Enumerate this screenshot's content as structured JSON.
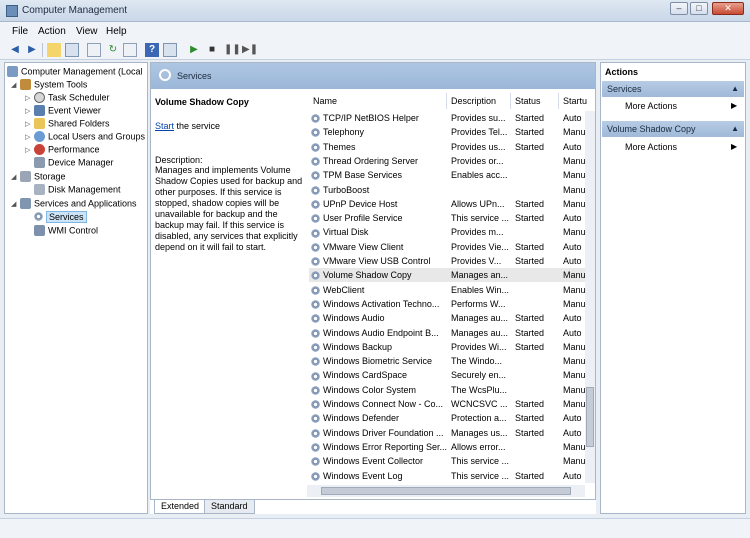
{
  "window": {
    "title": "Computer Management",
    "minimize": "–",
    "maximize": "□",
    "close": "✕"
  },
  "menu": [
    "File",
    "Action",
    "View",
    "Help"
  ],
  "tree": [
    {
      "label": "Computer Management (Local",
      "icon": "computer-icon",
      "arrow": ""
    },
    {
      "label": "System Tools",
      "icon": "tools-icon",
      "arrow": "◢"
    },
    {
      "label": "Task Scheduler",
      "icon": "clock-icon",
      "arrow": "▷"
    },
    {
      "label": "Event Viewer",
      "icon": "event-viewer-icon",
      "arrow": "▷"
    },
    {
      "label": "Shared Folders",
      "icon": "folder-icon",
      "arrow": "▷"
    },
    {
      "label": "Local Users and Groups",
      "icon": "users-icon",
      "arrow": "▷"
    },
    {
      "label": "Performance",
      "icon": "performance-icon",
      "arrow": "▷"
    },
    {
      "label": "Device Manager",
      "icon": "device-manager-icon",
      "arrow": ""
    },
    {
      "label": "Storage",
      "icon": "storage-icon",
      "arrow": "◢"
    },
    {
      "label": "Disk Management",
      "icon": "disk-icon",
      "arrow": ""
    },
    {
      "label": "Services and Applications",
      "icon": "services-apps-icon",
      "arrow": "◢"
    },
    {
      "label": "Services",
      "icon": "gear-icon",
      "arrow": ""
    },
    {
      "label": "WMI Control",
      "icon": "wmi-icon",
      "arrow": ""
    }
  ],
  "center": {
    "header_title": "Services",
    "selected_service": "Volume Shadow Copy",
    "start_link": "Start",
    "start_suffix": " the service",
    "desc_label": "Description:",
    "description": "Manages and implements Volume Shadow Copies used for backup and other purposes. If this service is stopped, shadow copies will be unavailable for backup and the backup may fail. If this service is disabled, any services that explicitly depend on it will fail to start."
  },
  "columns": [
    "Name",
    "Description",
    "Status",
    "Startu"
  ],
  "services": [
    {
      "name": "TCP/IP NetBIOS Helper",
      "desc": "Provides su...",
      "status": "Started",
      "startup": "Auto"
    },
    {
      "name": "Telephony",
      "desc": "Provides Tel...",
      "status": "Started",
      "startup": "Manu"
    },
    {
      "name": "Themes",
      "desc": "Provides us...",
      "status": "Started",
      "startup": "Auto"
    },
    {
      "name": "Thread Ordering Server",
      "desc": "Provides or...",
      "status": "",
      "startup": "Manu"
    },
    {
      "name": "TPM Base Services",
      "desc": "Enables acc...",
      "status": "",
      "startup": "Manu"
    },
    {
      "name": "TurboBoost",
      "desc": "",
      "status": "",
      "startup": "Manu"
    },
    {
      "name": "UPnP Device Host",
      "desc": "Allows UPn...",
      "status": "Started",
      "startup": "Manu"
    },
    {
      "name": "User Profile Service",
      "desc": "This service ...",
      "status": "Started",
      "startup": "Auto"
    },
    {
      "name": "Virtual Disk",
      "desc": "Provides m...",
      "status": "",
      "startup": "Manu"
    },
    {
      "name": "VMware View Client",
      "desc": "Provides Vie...",
      "status": "Started",
      "startup": "Auto"
    },
    {
      "name": "VMware View USB Control",
      "desc": "Provides V...",
      "status": "Started",
      "startup": "Auto"
    },
    {
      "name": "Volume Shadow Copy",
      "desc": "Manages an...",
      "status": "",
      "startup": "Manu"
    },
    {
      "name": "WebClient",
      "desc": "Enables Win...",
      "status": "",
      "startup": "Manu"
    },
    {
      "name": "Windows Activation Techno...",
      "desc": "Performs W...",
      "status": "",
      "startup": "Manu"
    },
    {
      "name": "Windows Audio",
      "desc": "Manages au...",
      "status": "Started",
      "startup": "Auto"
    },
    {
      "name": "Windows Audio Endpoint B...",
      "desc": "Manages au...",
      "status": "Started",
      "startup": "Auto"
    },
    {
      "name": "Windows Backup",
      "desc": "Provides Wi...",
      "status": "Started",
      "startup": "Manu"
    },
    {
      "name": "Windows Biometric Service",
      "desc": "The Windo...",
      "status": "",
      "startup": "Manu"
    },
    {
      "name": "Windows CardSpace",
      "desc": "Securely en...",
      "status": "",
      "startup": "Manu"
    },
    {
      "name": "Windows Color System",
      "desc": "The WcsPlu...",
      "status": "",
      "startup": "Manu"
    },
    {
      "name": "Windows Connect Now - Co...",
      "desc": "WCNCSVC ...",
      "status": "Started",
      "startup": "Manu"
    },
    {
      "name": "Windows Defender",
      "desc": "Protection a...",
      "status": "Started",
      "startup": "Auto"
    },
    {
      "name": "Windows Driver Foundation ...",
      "desc": "Manages us...",
      "status": "Started",
      "startup": "Auto"
    },
    {
      "name": "Windows Error Reporting Ser...",
      "desc": "Allows error...",
      "status": "",
      "startup": "Manu"
    },
    {
      "name": "Windows Event Collector",
      "desc": "This service ...",
      "status": "",
      "startup": "Manu"
    },
    {
      "name": "Windows Event Log",
      "desc": "This service ...",
      "status": "Started",
      "startup": "Auto"
    }
  ],
  "tabs": [
    "Extended",
    "Standard"
  ],
  "actions": {
    "title": "Actions",
    "sections": [
      {
        "label": "Services",
        "item": "More Actions"
      },
      {
        "label": "Volume Shadow Copy",
        "item": "More Actions"
      }
    ]
  },
  "colors": {
    "selection": "#cce4f7",
    "header": "#9bb7d8",
    "link": "#0645ad"
  }
}
